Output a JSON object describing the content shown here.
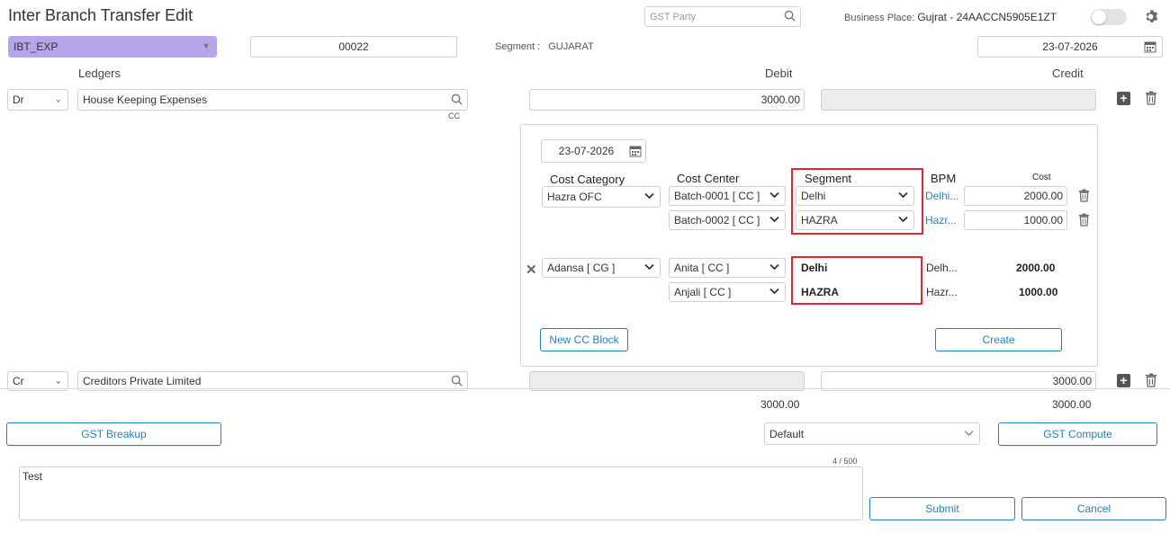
{
  "header": {
    "title": "Inter Branch Transfer Edit",
    "gst_party_placeholder": "GST Party",
    "business_place_label": "Business Place:",
    "business_place_value": "Gujrat - 24AACCN5905E1ZT"
  },
  "top_row": {
    "voucher_type": "IBT_EXP",
    "voucher_no": "00022",
    "segment_label": "Segment :",
    "segment_value": "GUJARAT",
    "date": "23-07-2026"
  },
  "columns": {
    "ledgers": "Ledgers",
    "debit": "Debit",
    "credit": "Credit"
  },
  "ledger_dr": {
    "type": "Dr",
    "name": "House Keeping Expenses",
    "cc_tag": "CC",
    "debit": "3000.00",
    "credit": ""
  },
  "cc_panel": {
    "date": "23-07-2026",
    "headers": {
      "cost_category": "Cost Category",
      "cost_center": "Cost Center",
      "segment": "Segment",
      "bpm": "BPM",
      "cost": "Cost"
    },
    "edit_block": {
      "category": "Hazra OFC",
      "rows": [
        {
          "center": "Batch-0001 [ CC ]",
          "segment": "Delhi",
          "bpm": "Delhi...",
          "cost": "2000.00"
        },
        {
          "center": "Batch-0002 [ CC ]",
          "segment": "HAZRA",
          "bpm": "Hazr...",
          "cost": "1000.00"
        }
      ]
    },
    "saved_block": {
      "category": "Adansa [ CG ]",
      "rows": [
        {
          "center": "Anita [ CC ]",
          "segment": "Delhi",
          "bpm": "Delh...",
          "cost": "2000.00"
        },
        {
          "center": "Anjali [ CC ]",
          "segment": "HAZRA",
          "bpm": "Hazr...",
          "cost": "1000.00"
        }
      ]
    },
    "new_cc_block_label": "New CC Block",
    "create_label": "Create"
  },
  "ledger_cr": {
    "type": "Cr",
    "name": "Creditors Private Limited",
    "debit": "",
    "credit": "3000.00"
  },
  "totals": {
    "debit": "3000.00",
    "credit": "3000.00"
  },
  "bottom": {
    "gst_breakup_label": "GST Breakup",
    "default_select": "Default",
    "gst_compute_label": "GST Compute",
    "narration": "Test",
    "char_count": "4 / 500",
    "submit_label": "Submit",
    "cancel_label": "Cancel"
  },
  "colors": {
    "accent": "#2b7fb8",
    "voucher_type_bg": "#b6a5ea",
    "highlight_border": "#e0262f"
  }
}
